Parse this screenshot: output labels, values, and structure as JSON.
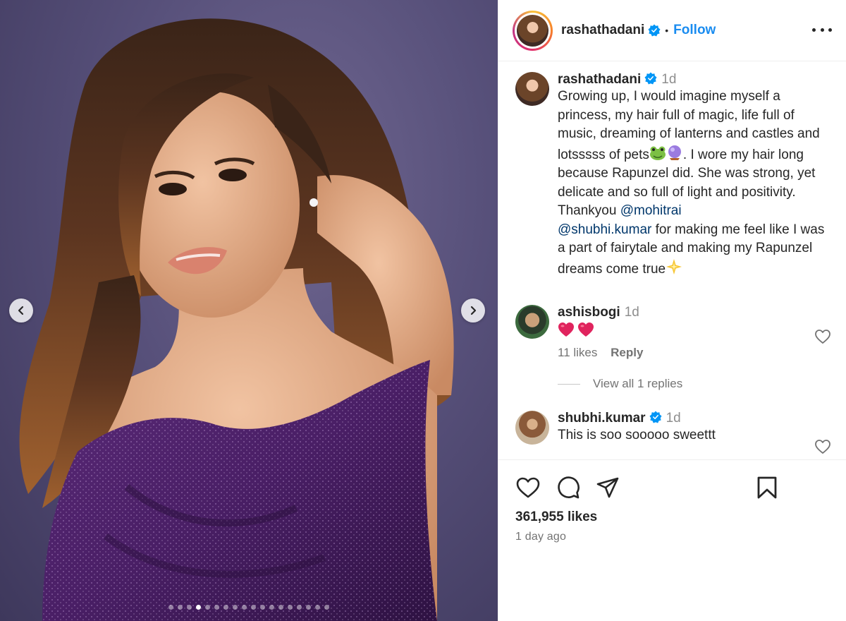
{
  "post": {
    "username": "rashathadani",
    "follow_label": "Follow",
    "separator": "•",
    "likes_text": "361,955 likes",
    "date_text": "1 day ago",
    "carousel": {
      "total_slides": 18,
      "active_index": 3
    }
  },
  "caption": {
    "username": "rashathadani",
    "time": "1d",
    "text_1": "Growing up, I would imagine myself a princess, my hair full of magic, life full of music, dreaming of lanterns and castles and lotsssss of pets",
    "text_2": ". I wore my hair long because Rapunzel did. She was strong, yet delicate and so full of light and positivity. Thankyou ",
    "mention_1": "@mohitrai",
    "mention_2": "@shubhi.kumar",
    "text_3": " for making me feel like I was a part of fairytale and making my Rapunzel dreams come true"
  },
  "comments": [
    {
      "username": "ashisbogi",
      "time": "1d",
      "text": "",
      "likes": "11 likes",
      "reply_label": "Reply",
      "view_replies": "View all 1 replies"
    },
    {
      "username": "shubhi.kumar",
      "time": "1d",
      "text": "This is soo sooooo sweettt"
    }
  ],
  "colors": {
    "link": "#1a8cf0",
    "mention": "#00376b",
    "muted": "#737373",
    "text": "#262626",
    "verified": "#0095f6",
    "heart_emoji": "#e0245e"
  },
  "icons": [
    "more-options-icon",
    "verified-badge-icon",
    "heart-icon",
    "comment-icon",
    "share-icon",
    "save-icon",
    "chevron-left-icon",
    "chevron-right-icon"
  ]
}
